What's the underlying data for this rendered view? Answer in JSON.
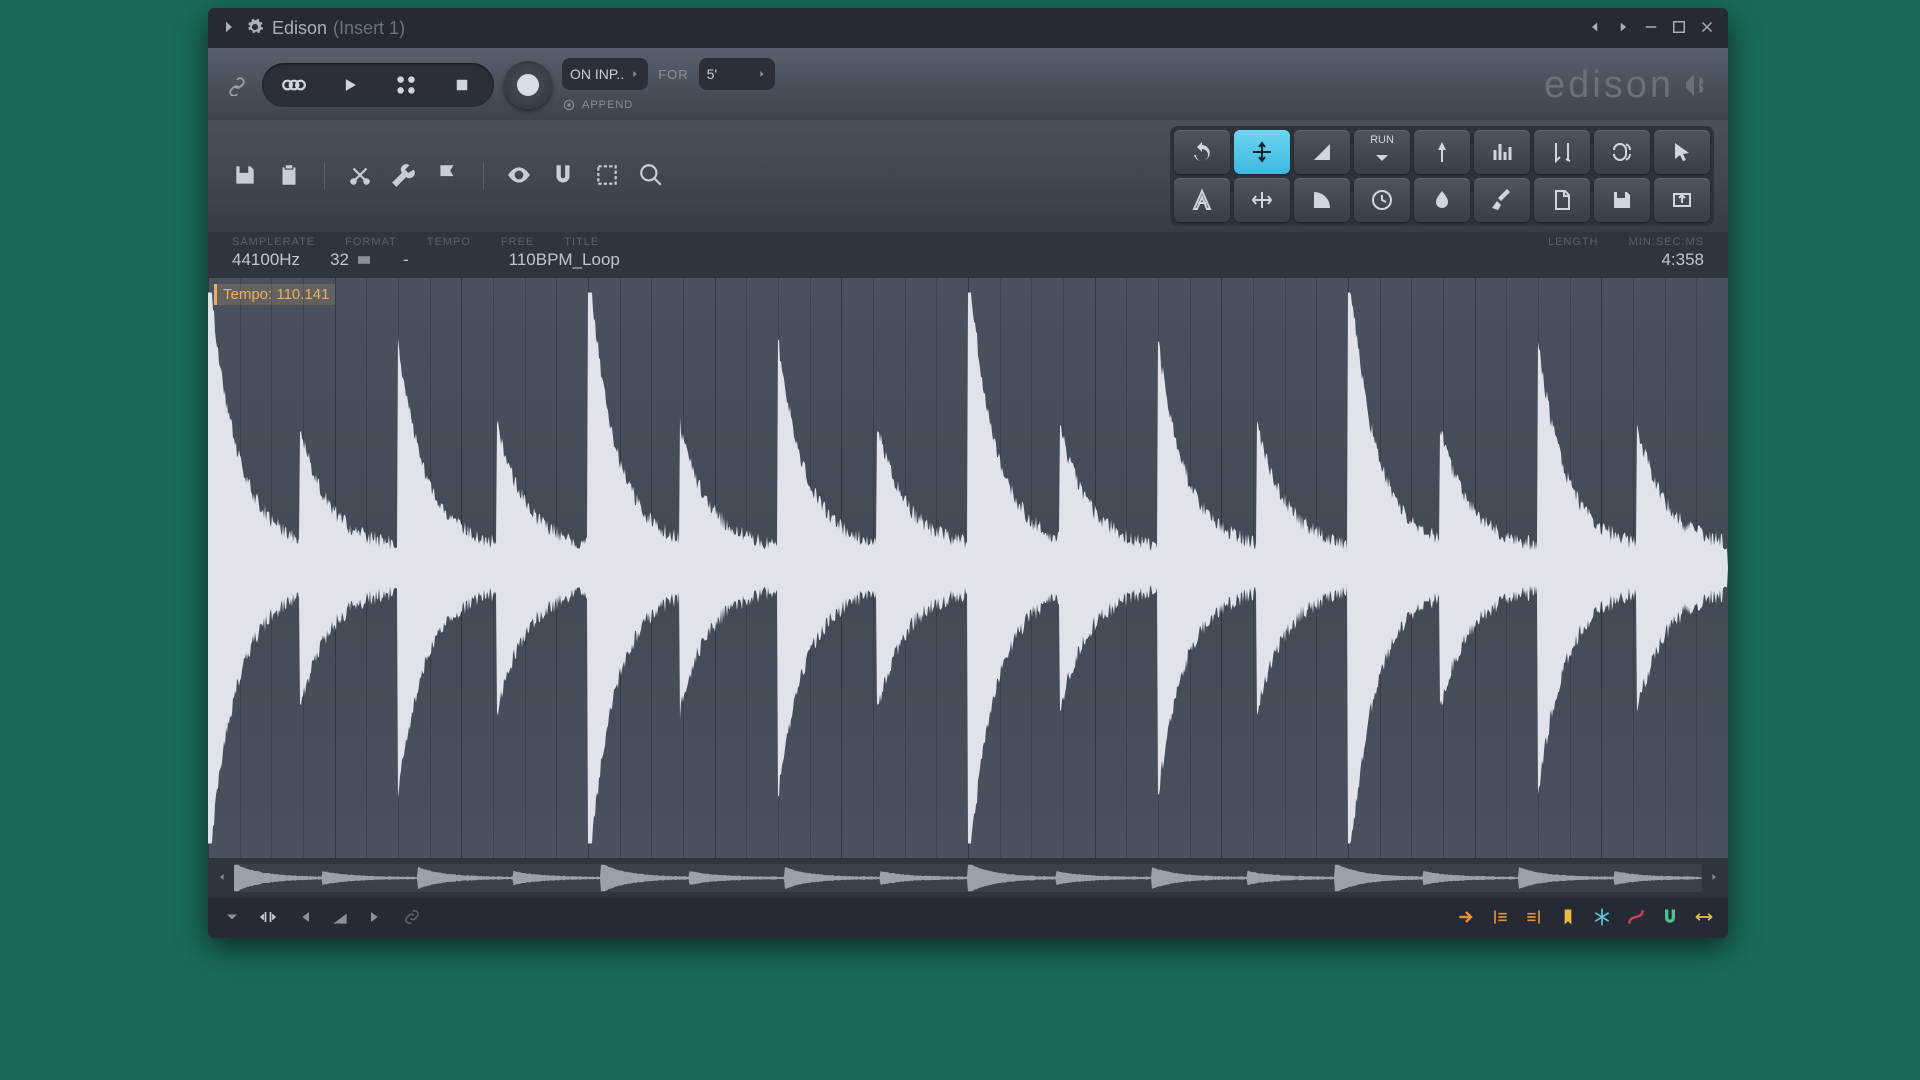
{
  "titlebar": {
    "title": "Edison",
    "subtitle": "(Insert 1)"
  },
  "transport": {
    "on_input": "ON INP..",
    "for_label": "FOR",
    "duration": "5'",
    "append": "APPEND"
  },
  "logo": "edison",
  "info": {
    "headers": {
      "samplerate": "SAMPLERATE",
      "format": "FORMAT",
      "tempo": "TEMPO",
      "free": "FREE",
      "title": "TITLE",
      "length": "LENGTH",
      "time": "MIN:SEC:MS"
    },
    "values": {
      "samplerate": "44100Hz",
      "format": "32",
      "tempo": "-",
      "free": "",
      "title": "110BPM_Loop",
      "length": "",
      "time": "4:358"
    }
  },
  "waveform": {
    "tempo_label": "Tempo: 110.141"
  },
  "tool_icons_row1": [
    "undo",
    "normalize",
    "fade",
    "run",
    "spectrum",
    "eq",
    "trim",
    "loop",
    "select"
  ],
  "tool_icons_row2": [
    "measure",
    "stretch",
    "envelope",
    "time",
    "blur",
    "brush",
    "script",
    "save",
    "send"
  ]
}
